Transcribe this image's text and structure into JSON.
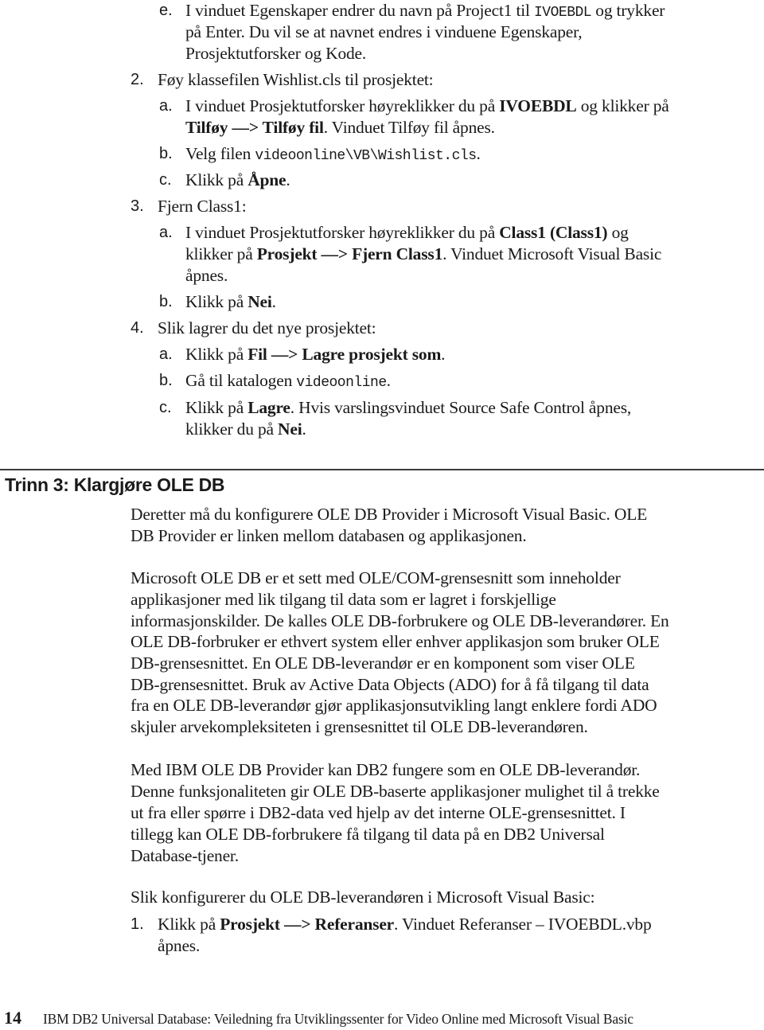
{
  "steps_top": {
    "e": {
      "marker": "e.",
      "lines": [
        [
          "I vinduet Egenskaper endrer du navn på Project1 til ",
          "IVOEBDL",
          " og trykker"
        ],
        "på Enter. Du vil se at navnet endres i vinduene Egenskaper,",
        "Prosjektutforsker og Kode."
      ]
    },
    "step2": {
      "marker": "2.",
      "title": "Føy klassefilen Wishlist.cls til prosjektet:",
      "a": {
        "marker": "a.",
        "line1_pre": "I vinduet Prosjektutforsker høyreklikker du på ",
        "line1_bold": "IVOEBDL",
        "line1_post": " og klikker på",
        "line2_bold": "Tilføy —> Tilføy fil",
        "line2_post": ". Vinduet Tilføy fil åpnes."
      },
      "b": {
        "marker": "b.",
        "pre": "Velg filen ",
        "code": "videoonline\\VB\\Wishlist.cls",
        "post": "."
      },
      "c": {
        "marker": "c.",
        "pre": "Klikk på ",
        "bold": "Åpne",
        "post": "."
      }
    },
    "step3": {
      "marker": "3.",
      "title": "Fjern Class1:",
      "a": {
        "marker": "a.",
        "line1_pre": "I vinduet Prosjektutforsker høyreklikker du på ",
        "line1_bold": "Class1 (Class1)",
        "line1_post": " og",
        "line2_pre": "klikker på ",
        "line2_bold": "Prosjekt —> Fjern Class1",
        "line2_post": ". Vinduet Microsoft Visual Basic",
        "line3": "åpnes."
      },
      "b": {
        "marker": "b.",
        "pre": "Klikk på ",
        "bold": "Nei",
        "post": "."
      }
    },
    "step4": {
      "marker": "4.",
      "title": "Slik lagrer du det nye prosjektet:",
      "a": {
        "marker": "a.",
        "pre": "Klikk på ",
        "bold": "Fil —> Lagre prosjekt som",
        "post": "."
      },
      "b": {
        "marker": "b.",
        "pre": "Gå til katalogen ",
        "code": "videoonline",
        "post": "."
      },
      "c": {
        "marker": "c.",
        "line1_pre": "Klikk på ",
        "line1_bold": "Lagre",
        "line1_post": ". Hvis varslingsvinduet Source Safe Control åpnes,",
        "line2_pre": "klikker du på ",
        "line2_bold": "Nei",
        "line2_post": "."
      }
    }
  },
  "section": {
    "heading": "Trinn 3: Klargjøre OLE DB",
    "para1": [
      "Deretter må du konfigurere OLE DB Provider i Microsoft Visual Basic. OLE",
      "DB Provider er linken mellom databasen og applikasjonen."
    ],
    "para2": [
      "Microsoft OLE DB er et sett med OLE/COM-grensesnitt som inneholder",
      "applikasjoner med lik tilgang til data som er lagret i forskjellige",
      "informasjonskilder. De kalles OLE DB-forbrukere og OLE DB-leverandører. En",
      "OLE DB-forbruker er ethvert system eller enhver applikasjon som bruker OLE",
      "DB-grensesnittet. En OLE DB-leverandør er en komponent som viser OLE",
      "DB-grensesnittet. Bruk av Active Data Objects (ADO) for å få tilgang til data",
      "fra en OLE DB-leverandør gjør applikasjonsutvikling langt enklere fordi ADO",
      "skjuler arvekompleksiteten i grensesnittet til OLE DB-leverandøren."
    ],
    "para3": [
      "Med IBM OLE DB Provider kan DB2 fungere som en OLE DB-leverandør.",
      "Denne funksjonaliteten gir OLE DB-baserte applikasjoner mulighet til å trekke",
      "ut fra eller spørre i DB2-data ved hjelp av det interne OLE-grensesnittet. I",
      "tillegg kan OLE DB-forbrukere få tilgang til data på en DB2 Universal",
      "Database-tjener."
    ],
    "para4": "Slik konfigurerer du OLE DB-leverandøren i Microsoft Visual Basic:",
    "step1": {
      "marker": "1.",
      "line1_pre": "Klikk på ",
      "line1_bold": "Prosjekt —> Referanser",
      "line1_post": ". Vinduet Referanser – IVOEBDL.vbp",
      "line2": "åpnes."
    }
  },
  "footer": {
    "page_number": "14",
    "title": "IBM DB2 Universal Database:  Veiledning fra Utviklingssenter for Video Online med Microsoft Visual Basic"
  }
}
